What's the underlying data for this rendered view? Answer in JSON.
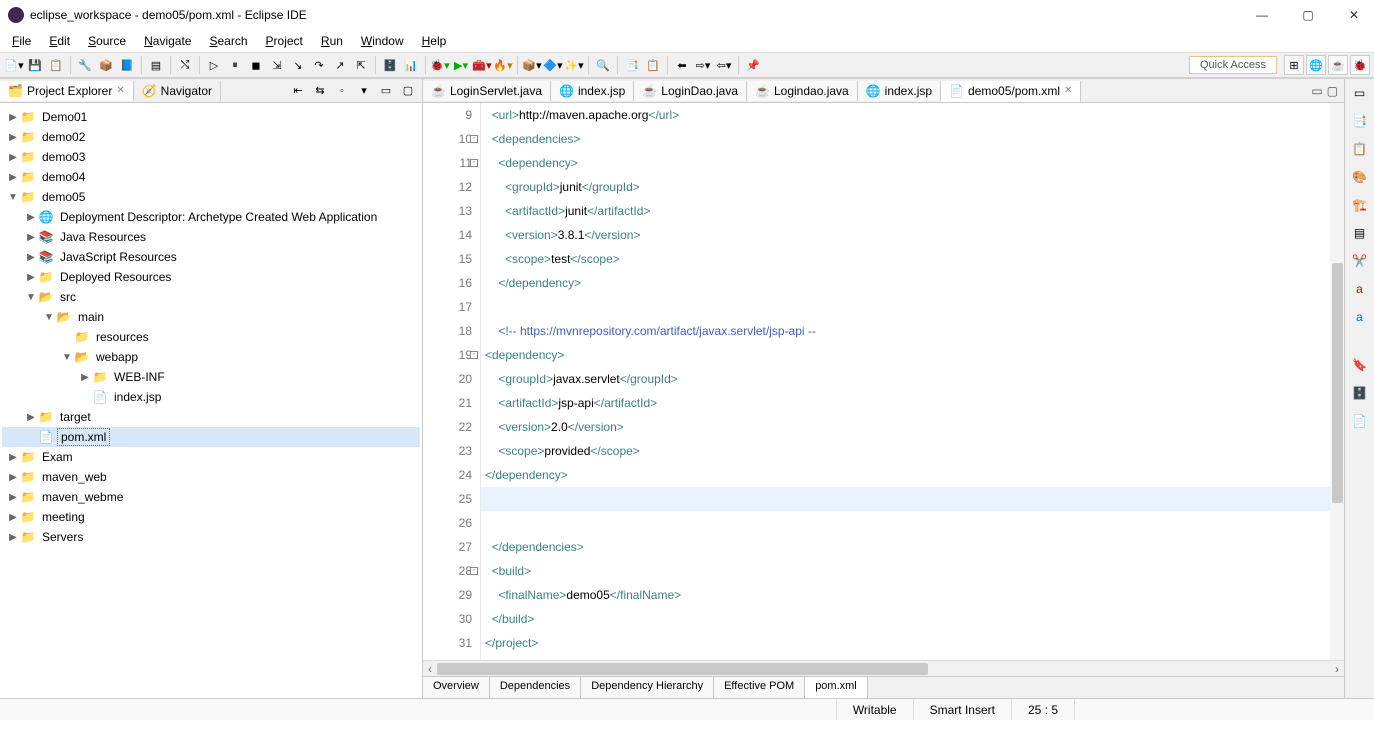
{
  "window": {
    "title": "eclipse_workspace - demo05/pom.xml - Eclipse IDE"
  },
  "menu": [
    "File",
    "Edit",
    "Source",
    "Navigate",
    "Search",
    "Project",
    "Run",
    "Window",
    "Help"
  ],
  "quick_access": "Quick Access",
  "project_explorer": {
    "tab": "Project Explorer",
    "nav_tab": "Navigator",
    "nodes": [
      {
        "d": 0,
        "a": "▶",
        "i": "proj",
        "t": "Demo01"
      },
      {
        "d": 0,
        "a": "▶",
        "i": "proj",
        "t": "demo02"
      },
      {
        "d": 0,
        "a": "▶",
        "i": "proj",
        "t": "demo03"
      },
      {
        "d": 0,
        "a": "▶",
        "i": "proj",
        "t": "demo04"
      },
      {
        "d": 0,
        "a": "▼",
        "i": "proj",
        "t": "demo05"
      },
      {
        "d": 1,
        "a": "▶",
        "i": "dd",
        "t": "Deployment Descriptor: Archetype Created Web Application"
      },
      {
        "d": 1,
        "a": "▶",
        "i": "lib",
        "t": "Java Resources"
      },
      {
        "d": 1,
        "a": "▶",
        "i": "lib",
        "t": "JavaScript Resources"
      },
      {
        "d": 1,
        "a": "▶",
        "i": "fold",
        "t": "Deployed Resources"
      },
      {
        "d": 1,
        "a": "▼",
        "i": "foldopen",
        "t": "src"
      },
      {
        "d": 2,
        "a": "▼",
        "i": "foldopen",
        "t": "main"
      },
      {
        "d": 3,
        "a": "",
        "i": "fold",
        "t": "resources"
      },
      {
        "d": 3,
        "a": "▼",
        "i": "foldopen",
        "t": "webapp"
      },
      {
        "d": 4,
        "a": "▶",
        "i": "fold",
        "t": "WEB-INF"
      },
      {
        "d": 4,
        "a": "",
        "i": "file",
        "t": "index.jsp"
      },
      {
        "d": 1,
        "a": "▶",
        "i": "fold",
        "t": "target"
      },
      {
        "d": 1,
        "a": "",
        "i": "xml",
        "t": "pom.xml",
        "sel": true
      },
      {
        "d": 0,
        "a": "▶",
        "i": "proj",
        "t": "Exam"
      },
      {
        "d": 0,
        "a": "▶",
        "i": "proj",
        "t": "maven_web"
      },
      {
        "d": 0,
        "a": "▶",
        "i": "proj",
        "t": "maven_webme"
      },
      {
        "d": 0,
        "a": "▶",
        "i": "proj",
        "t": "meeting"
      },
      {
        "d": 0,
        "a": "▶",
        "i": "proj",
        "t": "Servers"
      }
    ]
  },
  "editor_tabs": [
    {
      "label": "LoginServlet.java",
      "icon": "java"
    },
    {
      "label": "index.jsp",
      "icon": "jsp"
    },
    {
      "label": "LoginDao.java",
      "icon": "java"
    },
    {
      "label": "Logindao.java",
      "icon": "java"
    },
    {
      "label": "index.jsp",
      "icon": "jsp"
    },
    {
      "label": "demo05/pom.xml",
      "icon": "xml",
      "active": true
    }
  ],
  "code": {
    "start": 9,
    "lines": [
      {
        "n": 9,
        "html": "  <span class='tag'>&lt;url&gt;</span><span class='txt'>http://maven.apache.org</span><span class='tag'>&lt;/url&gt;</span>"
      },
      {
        "n": 10,
        "fold": "-",
        "html": "  <span class='tag'>&lt;dependencies&gt;</span>"
      },
      {
        "n": 11,
        "fold": "-",
        "html": "    <span class='tag'>&lt;dependency&gt;</span>"
      },
      {
        "n": 12,
        "html": "      <span class='tag'>&lt;groupId&gt;</span><span class='txt'>junit</span><span class='tag'>&lt;/groupId&gt;</span>"
      },
      {
        "n": 13,
        "html": "      <span class='tag'>&lt;artifactId&gt;</span><span class='txt'>junit</span><span class='tag'>&lt;/artifactId&gt;</span>"
      },
      {
        "n": 14,
        "html": "      <span class='tag'>&lt;version&gt;</span><span class='txt'>3.8.1</span><span class='tag'>&lt;/version&gt;</span>"
      },
      {
        "n": 15,
        "html": "      <span class='tag'>&lt;scope&gt;</span><span class='txt'>test</span><span class='tag'>&lt;/scope&gt;</span>"
      },
      {
        "n": 16,
        "html": "    <span class='tag'>&lt;/dependency&gt;</span>"
      },
      {
        "n": 17,
        "html": "    "
      },
      {
        "n": 18,
        "html": "    <span class='cmt'>&lt;!-- https://mvnrepository.com/artifact/javax.servlet/jsp-api --</span>",
        "mark": true
      },
      {
        "n": 19,
        "fold": "-",
        "html": "<span class='tag'>&lt;dependency&gt;</span>",
        "mark": true
      },
      {
        "n": 20,
        "html": "    <span class='tag'>&lt;groupId&gt;</span><span class='txt'>javax.servlet</span><span class='tag'>&lt;/groupId&gt;</span>",
        "mark": true
      },
      {
        "n": 21,
        "html": "    <span class='tag'>&lt;artifactId&gt;</span><span class='txt'>jsp-api</span><span class='tag'>&lt;/artifactId&gt;</span>",
        "mark": true
      },
      {
        "n": 22,
        "html": "    <span class='tag'>&lt;version&gt;</span><span class='txt'>2.0</span><span class='tag'>&lt;/version&gt;</span>",
        "mark": true
      },
      {
        "n": 23,
        "html": "    <span class='tag'>&lt;scope&gt;</span><span class='txt'>provided</span><span class='tag'>&lt;/scope&gt;</span>",
        "mark": true
      },
      {
        "n": 24,
        "html": "<span class='tag'>&lt;/dependency&gt;</span>",
        "mark": true
      },
      {
        "n": 25,
        "html": "    ",
        "current": true,
        "mark": true
      },
      {
        "n": 26,
        "html": "",
        "mark": true
      },
      {
        "n": 27,
        "html": "  <span class='tag'>&lt;/dependencies&gt;</span>",
        "mark": true
      },
      {
        "n": 28,
        "fold": "-",
        "html": "  <span class='tag'>&lt;build&gt;</span>"
      },
      {
        "n": 29,
        "html": "    <span class='tag'>&lt;finalName&gt;</span><span class='txt'>demo05</span><span class='tag'>&lt;/finalName&gt;</span>"
      },
      {
        "n": 30,
        "html": "  <span class='tag'>&lt;/build&gt;</span>"
      },
      {
        "n": 31,
        "html": "<span class='tag'>&lt;/project&gt;</span>"
      }
    ]
  },
  "bottom_tabs": [
    "Overview",
    "Dependencies",
    "Dependency Hierarchy",
    "Effective POM",
    "pom.xml"
  ],
  "bottom_active": "pom.xml",
  "status": {
    "writable": "Writable",
    "insert": "Smart Insert",
    "pos": "25 : 5"
  }
}
